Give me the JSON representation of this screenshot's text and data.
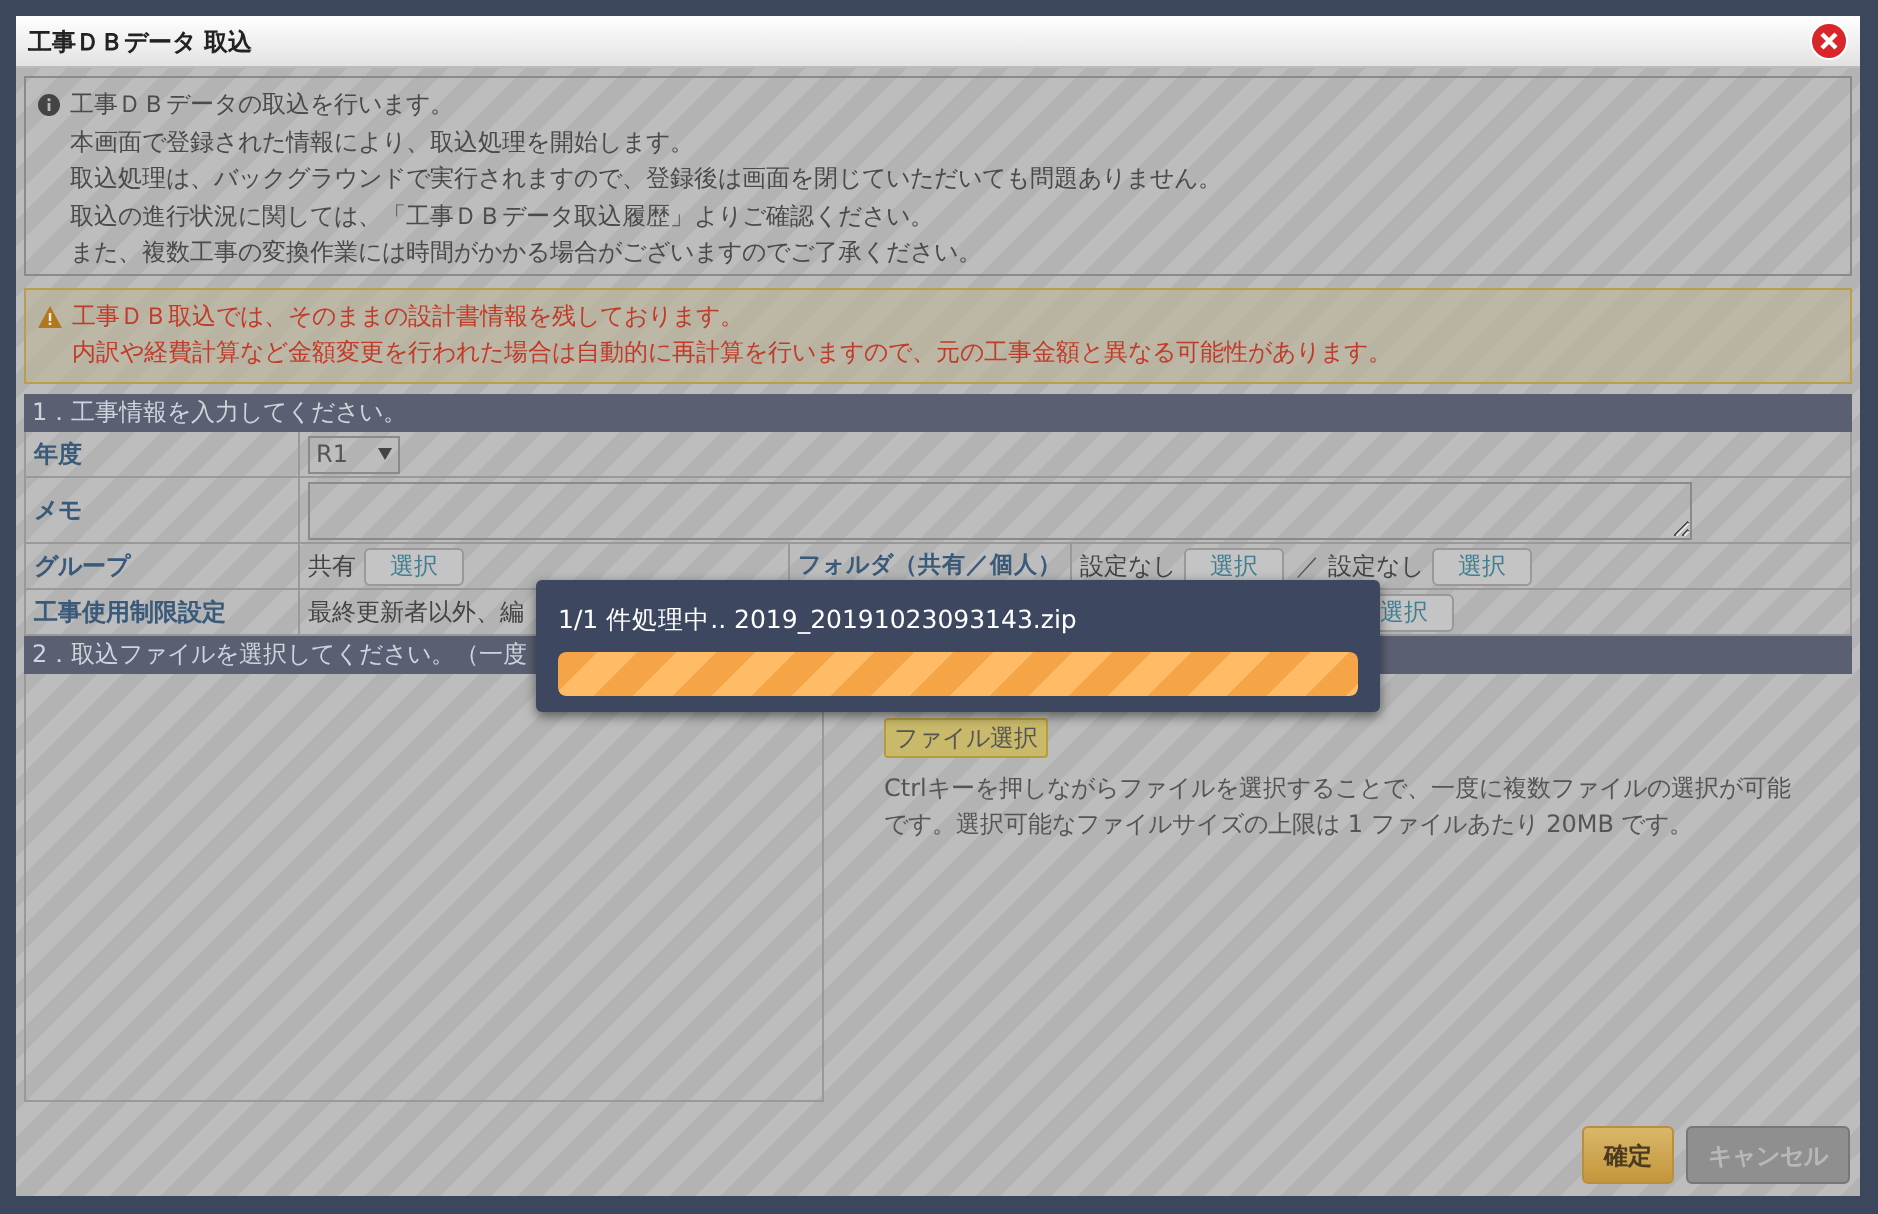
{
  "window": {
    "title": "工事ＤＢデータ 取込"
  },
  "info": {
    "lines": [
      "工事ＤＢデータの取込を行います。",
      "本画面で登録された情報により、取込処理を開始します。",
      "取込処理は、バックグラウンドで実行されますので、登録後は画面を閉じていただいても問題ありません。",
      "取込の進行状況に関しては、「工事ＤＢデータ取込履歴」よりご確認ください。",
      "また、複数工事の変換作業には時間がかかる場合がございますのでご了承ください。"
    ]
  },
  "warning": {
    "lines": [
      "工事ＤＢ取込では、そのままの設計書情報を残しております。",
      "内訳や経費計算など金額変更を行われた場合は自動的に再計算を行いますので、元の工事金額と異なる可能性があります。"
    ]
  },
  "section1": {
    "title": "1．工事情報を入力してください。"
  },
  "fields": {
    "year": {
      "label": "年度",
      "value": "R1"
    },
    "memo": {
      "label": "メモ"
    },
    "group": {
      "label": "グループ",
      "value": "共有",
      "button": "選択"
    },
    "folder": {
      "label": "フォルダ（共有／個人）",
      "shared": "設定なし",
      "shared_button": "選択",
      "separator": "／",
      "personal": "設定なし",
      "personal_button": "選択"
    },
    "restriction": {
      "label": "工事使用制限設定",
      "value": "最終更新者以外、編",
      "button": "選択"
    }
  },
  "section2": {
    "title": "2．取込ファイルを選択してください。（一度",
    "file_button": "ファイル選択",
    "help": "Ctrlキーを押しながらファイルを選択することで、一度に複数ファイルの選択が可能です。選択可能なファイルサイズの上限は 1 ファイルあたり 20MB です。"
  },
  "buttons": [
    {
      "label": "確定",
      "kind": "primary"
    },
    {
      "label": "キャンセル",
      "kind": "disabled"
    }
  ],
  "progress": {
    "text": "1/1 件処理中.. 2019_20191023093143.zip",
    "level": 1
  }
}
